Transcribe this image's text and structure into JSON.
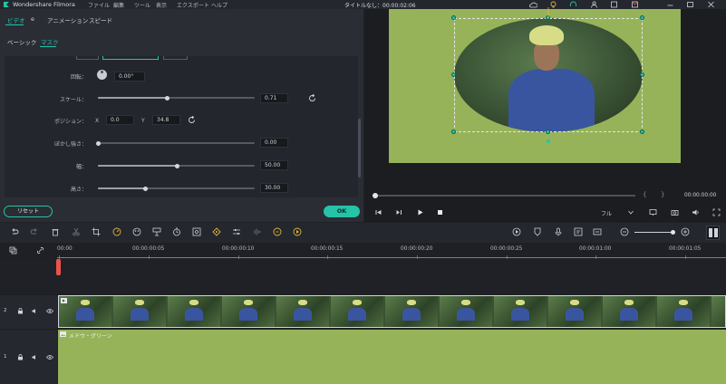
{
  "app": {
    "title": "Wondershare Filmora"
  },
  "menu": [
    "ファイル",
    "編集",
    "ツール",
    "表示",
    "エクスポート",
    "ヘルプ"
  ],
  "window_title": "タイトルなし：00:00:02:06",
  "tabs": {
    "video": "ビデオ",
    "audio_icon": "e",
    "animation": "アニメーション",
    "speed": "スピード"
  },
  "subtabs": {
    "basic": "ベーシック",
    "mask": "マスク"
  },
  "props": {
    "rotation": {
      "label": "回転：",
      "value": "0.00°"
    },
    "scale": {
      "label": "スケール：",
      "value": "0.71",
      "level": 0.44
    },
    "position": {
      "label": "ポジション：",
      "x_label": "X",
      "x_value": "0.0",
      "y_label": "Y",
      "y_value": "34.8"
    },
    "blur": {
      "label": "ぼかし強さ：",
      "value": "0.00",
      "level": 0.0
    },
    "width": {
      "label": "幅：",
      "value": "50.00",
      "level": 0.5
    },
    "height": {
      "label": "高さ：",
      "value": "30.00",
      "level": 0.3
    }
  },
  "buttons": {
    "reset": "リセット",
    "ok": "OK"
  },
  "player": {
    "time": "00:00:00:00",
    "bracket_in": "{",
    "bracket_out": "}",
    "quality": "フル",
    "progress": 0.0
  },
  "timeline": {
    "ticks": [
      "00:00",
      "00:00:00:05",
      "00:00:00:10",
      "00:00:00:15",
      "00:00:00:20",
      "00:00:00:25",
      "00:00:01:00",
      "00:00:01:05"
    ],
    "tracks": [
      {
        "index": "2",
        "clip_label": ""
      },
      {
        "index": "1",
        "clip_label": "メドウ・グリーン"
      }
    ]
  },
  "colors": {
    "accent": "#25c3a8",
    "canvas": "#96b35a",
    "playhead": "#e9544a"
  }
}
